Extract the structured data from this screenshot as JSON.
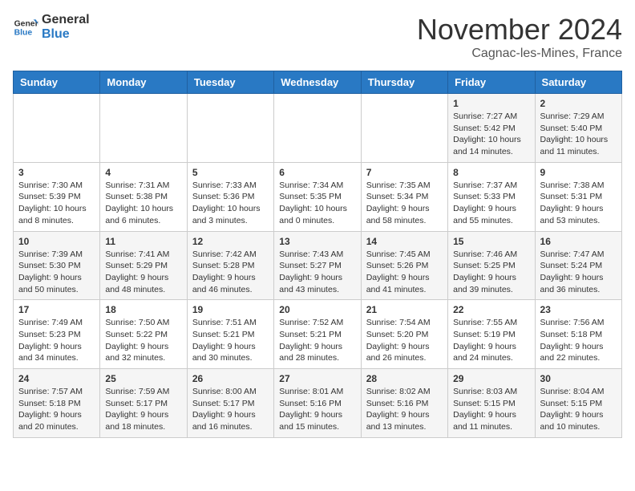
{
  "header": {
    "logo_line1": "General",
    "logo_line2": "Blue",
    "month": "November 2024",
    "location": "Cagnac-les-Mines, France"
  },
  "weekdays": [
    "Sunday",
    "Monday",
    "Tuesday",
    "Wednesday",
    "Thursday",
    "Friday",
    "Saturday"
  ],
  "weeks": [
    [
      {
        "day": "",
        "info": ""
      },
      {
        "day": "",
        "info": ""
      },
      {
        "day": "",
        "info": ""
      },
      {
        "day": "",
        "info": ""
      },
      {
        "day": "",
        "info": ""
      },
      {
        "day": "1",
        "info": "Sunrise: 7:27 AM\nSunset: 5:42 PM\nDaylight: 10 hours and 14 minutes."
      },
      {
        "day": "2",
        "info": "Sunrise: 7:29 AM\nSunset: 5:40 PM\nDaylight: 10 hours and 11 minutes."
      }
    ],
    [
      {
        "day": "3",
        "info": "Sunrise: 7:30 AM\nSunset: 5:39 PM\nDaylight: 10 hours and 8 minutes."
      },
      {
        "day": "4",
        "info": "Sunrise: 7:31 AM\nSunset: 5:38 PM\nDaylight: 10 hours and 6 minutes."
      },
      {
        "day": "5",
        "info": "Sunrise: 7:33 AM\nSunset: 5:36 PM\nDaylight: 10 hours and 3 minutes."
      },
      {
        "day": "6",
        "info": "Sunrise: 7:34 AM\nSunset: 5:35 PM\nDaylight: 10 hours and 0 minutes."
      },
      {
        "day": "7",
        "info": "Sunrise: 7:35 AM\nSunset: 5:34 PM\nDaylight: 9 hours and 58 minutes."
      },
      {
        "day": "8",
        "info": "Sunrise: 7:37 AM\nSunset: 5:33 PM\nDaylight: 9 hours and 55 minutes."
      },
      {
        "day": "9",
        "info": "Sunrise: 7:38 AM\nSunset: 5:31 PM\nDaylight: 9 hours and 53 minutes."
      }
    ],
    [
      {
        "day": "10",
        "info": "Sunrise: 7:39 AM\nSunset: 5:30 PM\nDaylight: 9 hours and 50 minutes."
      },
      {
        "day": "11",
        "info": "Sunrise: 7:41 AM\nSunset: 5:29 PM\nDaylight: 9 hours and 48 minutes."
      },
      {
        "day": "12",
        "info": "Sunrise: 7:42 AM\nSunset: 5:28 PM\nDaylight: 9 hours and 46 minutes."
      },
      {
        "day": "13",
        "info": "Sunrise: 7:43 AM\nSunset: 5:27 PM\nDaylight: 9 hours and 43 minutes."
      },
      {
        "day": "14",
        "info": "Sunrise: 7:45 AM\nSunset: 5:26 PM\nDaylight: 9 hours and 41 minutes."
      },
      {
        "day": "15",
        "info": "Sunrise: 7:46 AM\nSunset: 5:25 PM\nDaylight: 9 hours and 39 minutes."
      },
      {
        "day": "16",
        "info": "Sunrise: 7:47 AM\nSunset: 5:24 PM\nDaylight: 9 hours and 36 minutes."
      }
    ],
    [
      {
        "day": "17",
        "info": "Sunrise: 7:49 AM\nSunset: 5:23 PM\nDaylight: 9 hours and 34 minutes."
      },
      {
        "day": "18",
        "info": "Sunrise: 7:50 AM\nSunset: 5:22 PM\nDaylight: 9 hours and 32 minutes."
      },
      {
        "day": "19",
        "info": "Sunrise: 7:51 AM\nSunset: 5:21 PM\nDaylight: 9 hours and 30 minutes."
      },
      {
        "day": "20",
        "info": "Sunrise: 7:52 AM\nSunset: 5:21 PM\nDaylight: 9 hours and 28 minutes."
      },
      {
        "day": "21",
        "info": "Sunrise: 7:54 AM\nSunset: 5:20 PM\nDaylight: 9 hours and 26 minutes."
      },
      {
        "day": "22",
        "info": "Sunrise: 7:55 AM\nSunset: 5:19 PM\nDaylight: 9 hours and 24 minutes."
      },
      {
        "day": "23",
        "info": "Sunrise: 7:56 AM\nSunset: 5:18 PM\nDaylight: 9 hours and 22 minutes."
      }
    ],
    [
      {
        "day": "24",
        "info": "Sunrise: 7:57 AM\nSunset: 5:18 PM\nDaylight: 9 hours and 20 minutes."
      },
      {
        "day": "25",
        "info": "Sunrise: 7:59 AM\nSunset: 5:17 PM\nDaylight: 9 hours and 18 minutes."
      },
      {
        "day": "26",
        "info": "Sunrise: 8:00 AM\nSunset: 5:17 PM\nDaylight: 9 hours and 16 minutes."
      },
      {
        "day": "27",
        "info": "Sunrise: 8:01 AM\nSunset: 5:16 PM\nDaylight: 9 hours and 15 minutes."
      },
      {
        "day": "28",
        "info": "Sunrise: 8:02 AM\nSunset: 5:16 PM\nDaylight: 9 hours and 13 minutes."
      },
      {
        "day": "29",
        "info": "Sunrise: 8:03 AM\nSunset: 5:15 PM\nDaylight: 9 hours and 11 minutes."
      },
      {
        "day": "30",
        "info": "Sunrise: 8:04 AM\nSunset: 5:15 PM\nDaylight: 9 hours and 10 minutes."
      }
    ]
  ]
}
